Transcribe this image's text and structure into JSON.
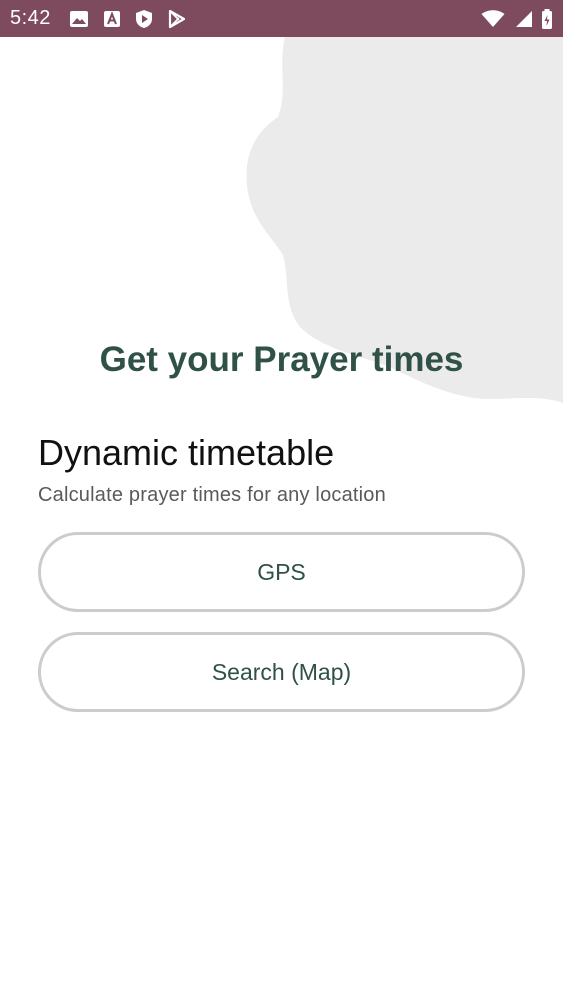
{
  "status_bar": {
    "time": "5:42",
    "left_icons": [
      "image-icon",
      "font-icon",
      "shield-play-icon",
      "play-store-icon"
    ],
    "right_icons": [
      "wifi-icon",
      "signal-icon",
      "battery-icon"
    ],
    "background_color": "#7d4b5d"
  },
  "main": {
    "title": "Get your Prayer times",
    "section": {
      "title": "Dynamic timetable",
      "subtitle": "Calculate prayer times for any location"
    },
    "buttons": {
      "gps_label": "GPS",
      "search_label": "Search (Map)"
    }
  },
  "colors": {
    "accent": "#2f5147",
    "blob": "#ebebeb",
    "button_border": "#c9cdcb"
  }
}
